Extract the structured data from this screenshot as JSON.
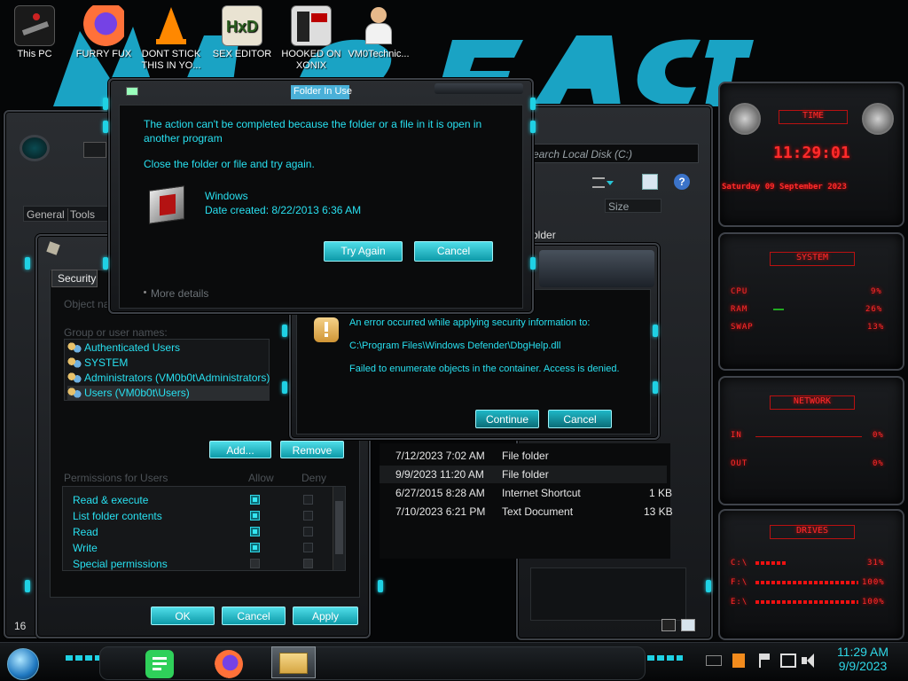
{
  "desktop": {
    "icons": [
      {
        "label": "This PC"
      },
      {
        "label": "FURRY FUX"
      },
      {
        "label": "DONT STICK THIS IN YO..."
      },
      {
        "label": "SEX EDITOR"
      },
      {
        "label": "HOOKED ON XONIX"
      },
      {
        "label": "VM0Technic..."
      }
    ]
  },
  "folder_in_use_dialog": {
    "title": "Folder In Use",
    "message": "The action can't be completed because the folder or a file in it is open in another program",
    "instruction": "Close the folder or file and try again.",
    "item_name": "Windows",
    "item_date": "Date created: 8/22/2013 6:36 AM",
    "try_again_label": "Try Again",
    "cancel_label": "Cancel",
    "more_details_label": "More details"
  },
  "security_error_dialog": {
    "message": "An error occurred while applying security information to:",
    "path": "C:\\Program Files\\Windows Defender\\DbgHelp.dll",
    "detail": "Failed to enumerate objects in the container. Access is denied.",
    "continue_label": "Continue",
    "cancel_label": "Cancel"
  },
  "properties_window": {
    "tabs": [
      "General",
      "Tools"
    ],
    "security_tab": "Security",
    "object_name_label": "Object na",
    "group_label": "Group or user names:",
    "users": [
      "Authenticated Users",
      "SYSTEM",
      "Administrators (VM0b0t\\Administrators)",
      "Users (VM0b0t\\Users)"
    ],
    "add_label": "Add...",
    "remove_label": "Remove",
    "permissions_label": "Permissions for Users",
    "allow_label": "Allow",
    "deny_label": "Deny",
    "permissions": [
      {
        "name": "Read & execute",
        "allow": true,
        "deny": false
      },
      {
        "name": "List folder contents",
        "allow": true,
        "deny": false
      },
      {
        "name": "Read",
        "allow": true,
        "deny": false
      },
      {
        "name": "Write",
        "allow": true,
        "deny": false
      },
      {
        "name": "Special permissions",
        "allow": false,
        "deny": false
      }
    ],
    "ok_label": "OK",
    "cancel_label": "Cancel",
    "apply_label": "Apply",
    "left_edge_text": "16"
  },
  "explorer": {
    "search_placeholder": "earch Local Disk (C:)",
    "size_header": "Size",
    "top_row_type": "older",
    "rows": [
      {
        "date": "7/12/2023 7:02 AM",
        "type": "File folder",
        "size": ""
      },
      {
        "date": "9/9/2023 11:20 AM",
        "type": "File folder",
        "size": ""
      },
      {
        "date": "6/27/2015 8:28 AM",
        "type": "Internet Shortcut",
        "size": "1 KB"
      },
      {
        "date": "7/10/2023 6:21 PM",
        "type": "Text Document",
        "size": "13 KB"
      }
    ]
  },
  "gadget": {
    "time_title": "TIME",
    "time": "11:29:01",
    "date": "Saturday 09 September 2023",
    "system_title": "SYSTEM",
    "cpu_label": "CPU",
    "cpu_value": "9%",
    "ram_label": "RAM",
    "ram_value": "26%",
    "swap_label": "SWAP",
    "swap_value": "13%",
    "network_title": "NETWORK",
    "in_label": "IN",
    "in_value": "0%",
    "out_label": "OUT",
    "out_value": "0%",
    "drives_title": "DRIVES",
    "drives": [
      {
        "label": "C:\\",
        "value": "31%"
      },
      {
        "label": "F:\\",
        "value": "100%"
      },
      {
        "label": "E:\\",
        "value": "100%"
      }
    ]
  },
  "taskbar": {
    "clock_time": "11:29 AM",
    "clock_date": "9/9/2023"
  },
  "colors": {
    "accent": "#28e0f0",
    "gadget_red": "#ff2b2b",
    "graffiti": "#1aa3c4"
  }
}
